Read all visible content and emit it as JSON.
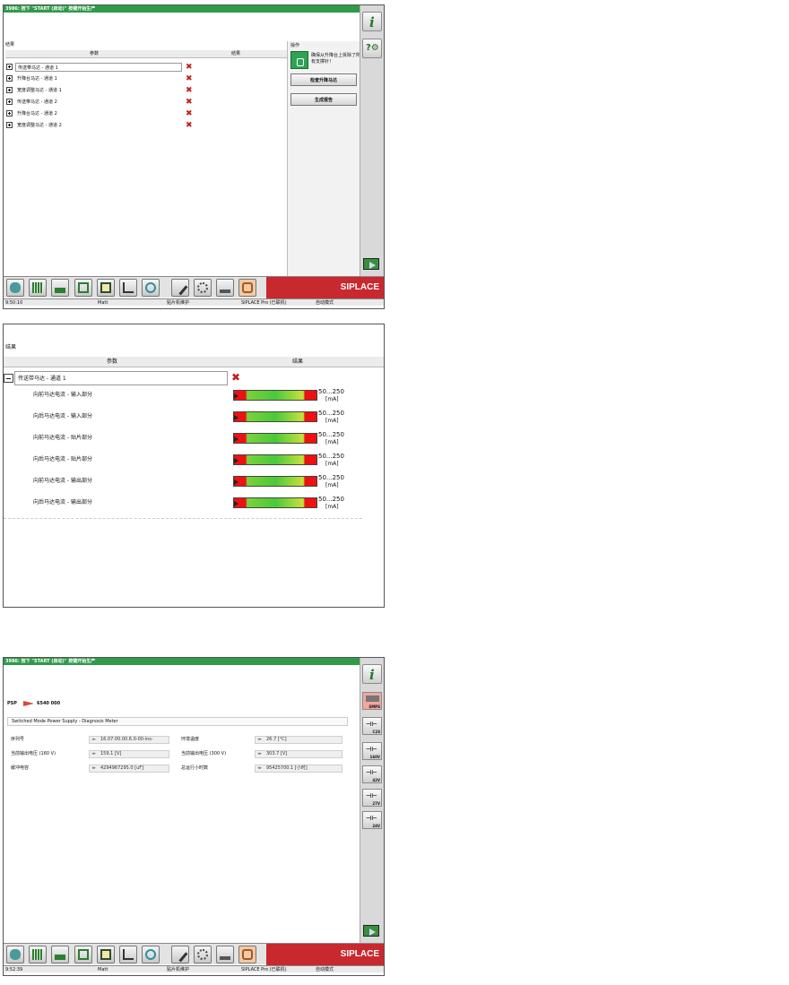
{
  "panel1": {
    "title": "3986: 按下 \"START (启动)\" 按键开始生产",
    "results_header": "结果",
    "col_param": "参数",
    "col_result": "结果",
    "ops_header": "操作",
    "ops_message": "确保从升降台上拆除了所有支撑针！",
    "btn_check_lift": "检查升降马达",
    "btn_report": "生成报告",
    "rows": [
      {
        "label": "传送带马达 - 通道 1"
      },
      {
        "label": "升降台马达 - 通道 1"
      },
      {
        "label": "宽度调整马达 - 通道 1"
      },
      {
        "label": "传送带马达 - 通道 2"
      },
      {
        "label": "升降台马达 - 通道 2"
      },
      {
        "label": "宽度调整马达 - 通道 2"
      }
    ],
    "brand": "SIPLACE",
    "status": {
      "time": "9:50:10",
      "user": "Matt",
      "mode": "贴片机维护",
      "machine": "SIPLACE Pro (已联机)",
      "auto": "自动模式"
    }
  },
  "panel2": {
    "results_header": "结果",
    "col_param": "参数",
    "col_result": "结果",
    "group_label": "传送带马达 - 通道 1",
    "rows": [
      {
        "label": "向前马达电流 - 输入部分",
        "range": "50...250",
        "unit": "[mA]"
      },
      {
        "label": "向后马达电流 - 输入部分",
        "range": "50...250",
        "unit": "[mA]"
      },
      {
        "label": "向前马达电流 - 贴片部分",
        "range": "50...250",
        "unit": "[mA]"
      },
      {
        "label": "向后马达电流 - 贴片部分",
        "range": "50...250",
        "unit": "[mA]"
      },
      {
        "label": "向前马达电流 - 输出部分",
        "range": "50...250",
        "unit": "[mA]"
      },
      {
        "label": "向后马达电流 - 输出部分",
        "range": "50...250",
        "unit": "[mA]"
      }
    ]
  },
  "panel3": {
    "title": "3986: 按下 \"START (启动)\" 按键开始生产",
    "breadcrumb_root": "PSP",
    "breadcrumb_item": "6540 000",
    "section_title": "Switched Mode Power Supply - Diagnosis Meter",
    "fields": [
      {
        "label": "序列号",
        "value": "16.07.00.00.6.0-00-ins-"
      },
      {
        "label": "环境温度",
        "value": "26.7 [°C]"
      },
      {
        "label": "当前输出电压 (160 V)",
        "value": "159.1 [V]"
      },
      {
        "label": "当前输出电压 (300 V)",
        "value": "303.7 [V]"
      },
      {
        "label": "缓冲电容",
        "value": "4294967295.0 [uF]"
      },
      {
        "label": "总运行小时数",
        "value": "95425700.1 [小时]"
      }
    ],
    "side_buttons": [
      "SMPS",
      "C28",
      "160V",
      "42V",
      "27V",
      "24V"
    ],
    "brand": "SIPLACE",
    "status": {
      "time": "9:52:39",
      "user": "Matt",
      "mode": "贴片机维护",
      "machine": "SIPLACE Pro (已联机)",
      "auto": "自动模式"
    }
  }
}
